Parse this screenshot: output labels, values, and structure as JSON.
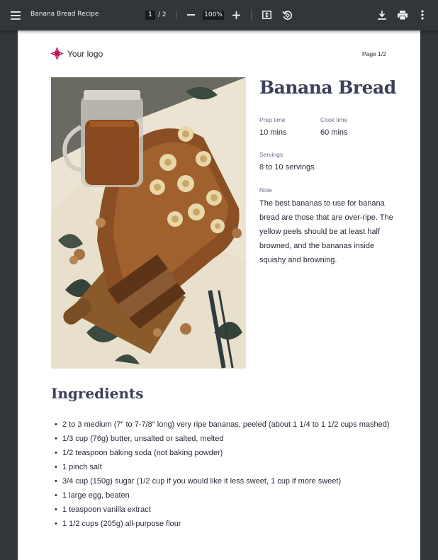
{
  "toolbar": {
    "title": "Banana Bread Recipe",
    "page_current": "1",
    "page_total": "/ 2",
    "zoom": "100%",
    "icons": [
      "menu-icon",
      "zoom-out-icon",
      "zoom-in-icon",
      "fit-to-page-icon",
      "rotate-icon",
      "download-icon",
      "print-icon",
      "more-vert-icon"
    ]
  },
  "document": {
    "logo_text": "Your logo",
    "page_label": "Page 1/2",
    "recipe_title": "Banana Bread",
    "prep_time_label": "Prep time",
    "prep_time_value": "10 mins",
    "cook_time_label": "Cook time",
    "cook_time_value": "60 mins",
    "servings_label": "Servings",
    "servings_value": "8 to 10 servings",
    "note_label": "Note",
    "note_text": "The best bananas to use for banana bread are those that are over-ripe. The yellow peels should be at least half browned, and the bananas inside squishy and browning.",
    "ingredients_heading": "Ingredients",
    "ingredients": [
      "2 to 3 medium (7\" to 7-7/8\" long) very ripe bananas, peeled (about 1 1/4 to 1 1/2 cups mashed)",
      "1/3 cup (76g) butter, unsalted or salted, melted",
      "1/2 teaspoon baking soda (not baking powder)",
      "1 pinch salt",
      "3/4 cup (150g) sugar (1/2 cup if you would like it less sweet, 1 cup if more sweet)",
      "1 large egg, beaten",
      "1 teaspoon vanilla extract",
      "1 1/2 cups (205g) all-purpose flour"
    ]
  },
  "colors": {
    "toolbar_bg": "#323639",
    "heading": "#3d405b",
    "logo_accent": "#c2185b"
  }
}
